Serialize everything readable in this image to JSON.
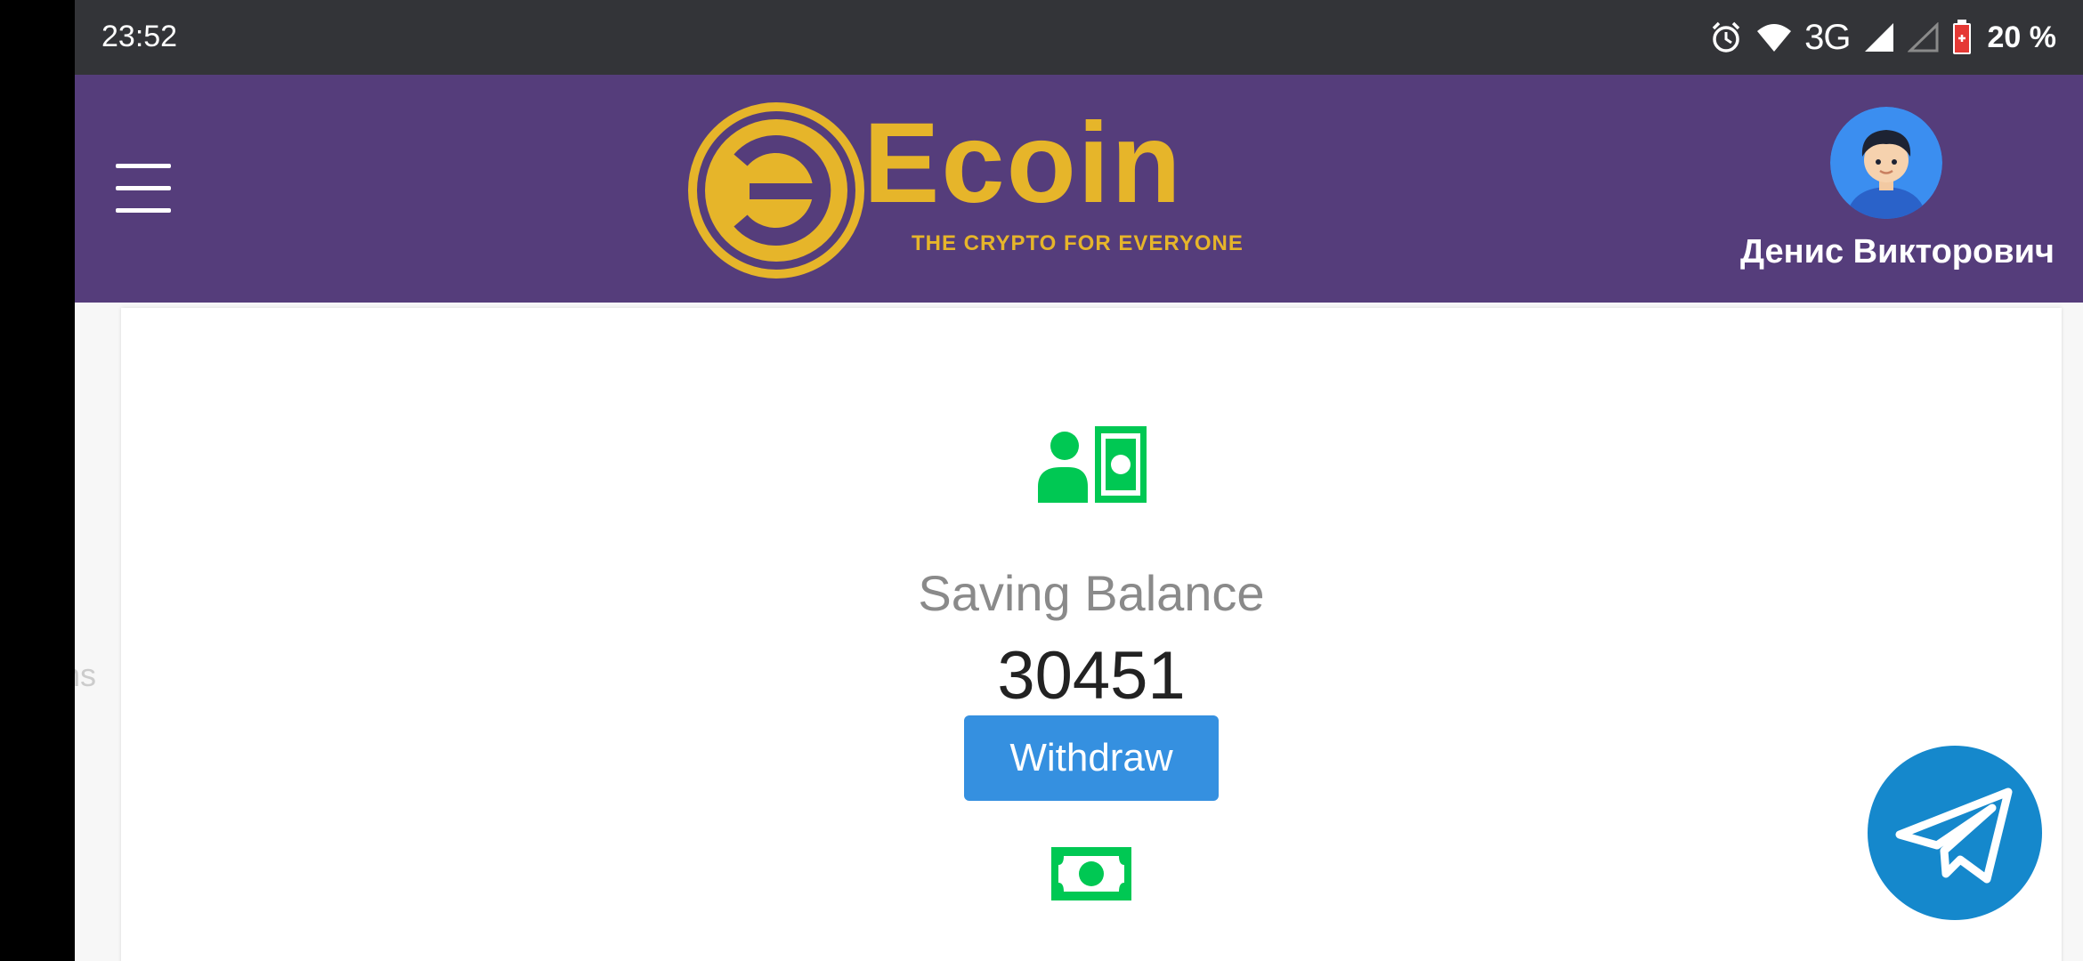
{
  "status_bar": {
    "time": "23:52",
    "network": "3G",
    "battery": "20 %",
    "icons": [
      "alarm-icon",
      "wifi-icon",
      "signal-icon",
      "signal-empty-icon",
      "battery-low-icon"
    ]
  },
  "header": {
    "brand_name": "Ecoin",
    "brand_tagline": "THE CRYPTO FOR EVERYONE",
    "user_name": "Денис Викторович",
    "colors": {
      "background": "#553d7b",
      "brand_gold": "#e6b52a"
    }
  },
  "edge_text": "ns",
  "balance": {
    "label": "Saving Balance",
    "value": "30451",
    "withdraw_label": "Withdraw",
    "icon": "user-money-icon",
    "icon_color": "#00c853"
  },
  "next_section": {
    "icon": "money-bill-icon"
  },
  "floating": {
    "icon": "telegram-icon",
    "color": "#1588cc"
  },
  "accent_button_color": "#3590e0"
}
